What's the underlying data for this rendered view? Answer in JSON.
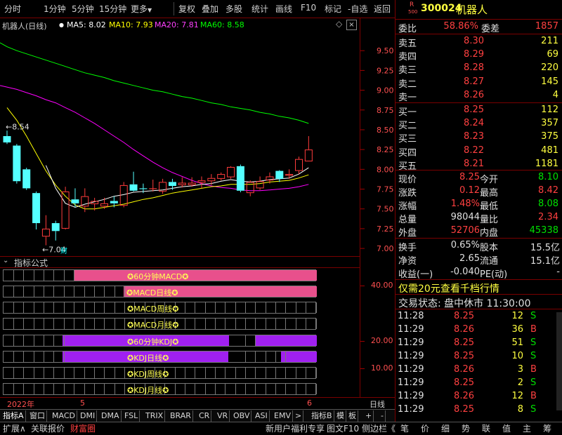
{
  "toolbar": {
    "items": [
      "分时",
      "1分钟",
      "5分钟",
      "15分钟",
      "更多",
      "复权",
      "叠加",
      "多股",
      "统计",
      "画线",
      "F10",
      "标记",
      "-自选",
      "返回"
    ]
  },
  "chart": {
    "title": "机器人(日线)",
    "ma5_label": "MA5: 8.02",
    "ma10_label": "MA10: 7.93",
    "ma20_label": "MA20: 7.81",
    "ma60_label": "MA60: 8.58",
    "colors": {
      "ma5": "#ffffff",
      "ma10": "#ffff00",
      "ma20": "#ff00ff",
      "ma60": "#00ff00",
      "up": "#ff3c3c",
      "down": "#54ffff"
    }
  },
  "chart_data": {
    "type": "candlestick",
    "ylim": [
      6.93,
      9.75
    ],
    "y_ticks": [
      "9.50",
      "9.25",
      "9.00",
      "8.75",
      "8.50",
      "8.25",
      "8.00",
      "7.75",
      "7.50",
      "7.25",
      "7.00"
    ],
    "high_label": "8.54",
    "low_label": "7.04",
    "candles": [
      {
        "o": 8.42,
        "c": 8.34,
        "h": 8.49,
        "l": 8.32
      },
      {
        "o": 8.3,
        "c": 7.85,
        "h": 8.32,
        "l": 7.82
      },
      {
        "o": 8.0,
        "c": 7.76,
        "h": 8.02,
        "l": 7.74
      },
      {
        "o": 7.7,
        "c": 7.32,
        "h": 7.72,
        "l": 7.24
      },
      {
        "o": 7.15,
        "c": 7.25,
        "h": 7.42,
        "l": 7.04
      },
      {
        "o": 7.32,
        "c": 7.22,
        "h": 7.35,
        "l": 7.1
      },
      {
        "o": 7.25,
        "c": 7.72,
        "h": 7.78,
        "l": 7.24
      },
      {
        "o": 7.62,
        "c": 7.57,
        "h": 7.76,
        "l": 7.52
      },
      {
        "o": 7.53,
        "c": 7.66,
        "h": 7.76,
        "l": 7.46
      },
      {
        "o": 7.56,
        "c": 7.6,
        "h": 7.64,
        "l": 7.48
      },
      {
        "o": 7.53,
        "c": 7.57,
        "h": 7.64,
        "l": 7.5
      },
      {
        "o": 7.6,
        "c": 7.57,
        "h": 7.66,
        "l": 7.52
      },
      {
        "o": 7.54,
        "c": 7.8,
        "h": 7.84,
        "l": 7.52
      },
      {
        "o": 7.81,
        "c": 7.73,
        "h": 7.97,
        "l": 7.72
      },
      {
        "o": 7.76,
        "c": 7.75,
        "h": 7.82,
        "l": 7.7
      },
      {
        "o": 7.75,
        "c": 7.76,
        "h": 7.87,
        "l": 7.72
      },
      {
        "o": 7.72,
        "c": 7.84,
        "h": 7.88,
        "l": 7.69
      },
      {
        "o": 7.84,
        "c": 7.79,
        "h": 7.88,
        "l": 7.74
      },
      {
        "o": 7.8,
        "c": 7.83,
        "h": 7.9,
        "l": 7.77
      },
      {
        "o": 7.8,
        "c": 7.83,
        "h": 7.9,
        "l": 7.78
      },
      {
        "o": 7.83,
        "c": 7.86,
        "h": 7.91,
        "l": 7.76
      },
      {
        "o": 7.85,
        "c": 7.89,
        "h": 7.94,
        "l": 7.8
      },
      {
        "o": 7.88,
        "c": 7.94,
        "h": 7.96,
        "l": 7.86
      },
      {
        "o": 7.9,
        "c": 8.03,
        "h": 8.04,
        "l": 7.88
      },
      {
        "o": 8.04,
        "c": 7.73,
        "h": 8.06,
        "l": 7.71
      },
      {
        "o": 7.7,
        "c": 7.84,
        "h": 7.86,
        "l": 7.66
      },
      {
        "o": 7.76,
        "c": 7.85,
        "h": 7.91,
        "l": 7.74
      },
      {
        "o": 7.86,
        "c": 7.91,
        "h": 7.96,
        "l": 7.82
      },
      {
        "o": 7.98,
        "c": 7.88,
        "h": 7.99,
        "l": 7.84
      },
      {
        "o": 7.92,
        "c": 7.94,
        "h": 8.0,
        "l": 7.88
      },
      {
        "o": 7.98,
        "c": 8.13,
        "h": 8.16,
        "l": 7.94
      },
      {
        "o": 8.1,
        "c": 8.25,
        "h": 8.42,
        "l": 8.1
      }
    ],
    "ma5": [
      null,
      null,
      null,
      null,
      8.05,
      7.76,
      7.57,
      7.52,
      7.56,
      7.59,
      7.62,
      7.66,
      7.68,
      7.71,
      7.72,
      7.73,
      7.74,
      7.76,
      7.78,
      7.79,
      7.81,
      7.82,
      7.85,
      7.87,
      7.85,
      7.84,
      7.85,
      7.87,
      7.88,
      7.89,
      7.94,
      8.02
    ],
    "ma10": [
      8.78,
      8.62,
      8.42,
      8.2,
      7.98,
      7.8,
      7.66,
      7.55,
      7.5,
      7.5,
      7.52,
      7.54,
      7.56,
      7.59,
      7.62,
      7.64,
      7.67,
      7.7,
      7.72,
      7.74,
      7.76,
      7.78,
      7.79,
      7.81,
      7.81,
      7.81,
      7.82,
      7.84,
      7.85,
      7.86,
      7.89,
      7.93
    ],
    "ma20": [
      9.04,
      9.01,
      8.97,
      8.93,
      8.88,
      8.84,
      8.78,
      8.72,
      8.65,
      8.58,
      8.5,
      8.42,
      8.34,
      8.25,
      8.17,
      8.09,
      8.02,
      7.96,
      7.91,
      7.86,
      7.82,
      7.79,
      7.77,
      7.76,
      7.74,
      7.73,
      7.73,
      7.74,
      7.75,
      7.76,
      7.78,
      7.81
    ],
    "ma60": [
      9.55,
      9.5,
      9.46,
      9.42,
      9.38,
      9.34,
      9.3,
      9.26,
      9.22,
      9.19,
      9.16,
      9.12,
      9.09,
      9.06,
      9.03,
      9.0,
      8.98,
      8.95,
      8.92,
      8.9,
      8.87,
      8.84,
      8.82,
      8.79,
      8.77,
      8.75,
      8.72,
      8.7,
      8.67,
      8.65,
      8.62,
      8.58
    ],
    "indicator_ticks": [
      "40.00",
      "20.00",
      "10.00"
    ]
  },
  "indicator": {
    "header": "指标公式",
    "rows": [
      {
        "label": "✪60分钟MACD✪",
        "color": "#e8508c"
      },
      {
        "label": "✪MACD日线✪",
        "color": "#e8508c"
      },
      {
        "label": "✪MACD周线✪",
        "color": ""
      },
      {
        "label": "✪MACD月线✪",
        "color": ""
      },
      {
        "label": "✪60分钟KDJ✪",
        "color": "#a020f0"
      },
      {
        "label": "✪KDJ日线✪",
        "color": "#a020f0"
      },
      {
        "label": "✪KDJ周线✪",
        "color": ""
      },
      {
        "label": "✪KDJ月线✪",
        "color": ""
      }
    ]
  },
  "date_bar": {
    "year": "2022年",
    "m5": "5",
    "m6": "6",
    "period": "日线"
  },
  "tabs": [
    "指标A",
    "窗口",
    "MACD",
    "DMI",
    "DMA",
    "FSL",
    "TRIX",
    "BRAR",
    "CR",
    "VR",
    "OBV",
    "ASI",
    "EMV",
    ">",
    "指标B",
    "模",
    "板",
    "+",
    "-"
  ],
  "status": {
    "left": [
      "扩展∧",
      "关联报价",
      "财富圈"
    ],
    "mid": [
      "新用户福利专享",
      "图文F10",
      "侧边栏《"
    ],
    "right": [
      "笔",
      "价",
      "细",
      "势",
      "联",
      "值",
      "主",
      "筹"
    ]
  },
  "quote": {
    "code": "300024",
    "name": "机器人",
    "badge_top": "R",
    "badge_bottom": "500",
    "weibi_label": "委比",
    "weibi": "58.86%",
    "weicha_label": "委差",
    "weicha": "1857",
    "asks": [
      {
        "label": "卖五",
        "price": "8.30",
        "vol": "211"
      },
      {
        "label": "卖四",
        "price": "8.29",
        "vol": "69"
      },
      {
        "label": "卖三",
        "price": "8.28",
        "vol": "220"
      },
      {
        "label": "卖二",
        "price": "8.27",
        "vol": "145"
      },
      {
        "label": "卖一",
        "price": "8.26",
        "vol": "4"
      }
    ],
    "bids": [
      {
        "label": "买一",
        "price": "8.25",
        "vol": "112"
      },
      {
        "label": "买二",
        "price": "8.24",
        "vol": "357"
      },
      {
        "label": "买三",
        "price": "8.23",
        "vol": "375"
      },
      {
        "label": "买四",
        "price": "8.22",
        "vol": "481"
      },
      {
        "label": "买五",
        "price": "8.21",
        "vol": "1181"
      }
    ],
    "stats": [
      {
        "l1": "现价",
        "v1": "8.25",
        "c1": "red",
        "l2": "今开",
        "v2": "8.10",
        "c2": "green"
      },
      {
        "l1": "涨跌",
        "v1": "0.12",
        "c1": "red",
        "l2": "最高",
        "v2": "8.42",
        "c2": "red"
      },
      {
        "l1": "涨幅",
        "v1": "1.48%",
        "c1": "red",
        "l2": "最低",
        "v2": "8.08",
        "c2": "green"
      },
      {
        "l1": "总量",
        "v1": "98044",
        "c1": "white",
        "l2": "量比",
        "v2": "2.34",
        "c2": "red"
      },
      {
        "l1": "外盘",
        "v1": "52706",
        "c1": "red",
        "l2": "内盘",
        "v2": "45338",
        "c2": "green"
      }
    ],
    "stats2": [
      {
        "l1": "换手",
        "v1": "0.65%",
        "l2": "股本",
        "v2": "15.5亿"
      },
      {
        "l1": "净资",
        "v1": "2.65",
        "l2": "流通",
        "v2": "15.1亿"
      },
      {
        "l1": "收益(一)",
        "v1": "-0.040",
        "l2": "PE(动)",
        "v2": "-"
      }
    ],
    "promo": "仅需20元查看千档行情",
    "trade_status": "交易状态: 盘中休市 11:30:00",
    "ticks": [
      {
        "time": "11:28",
        "price": "8.25",
        "vol": "12",
        "side": "S"
      },
      {
        "time": "11:29",
        "price": "8.26",
        "vol": "36",
        "side": "B"
      },
      {
        "time": "11:29",
        "price": "8.25",
        "vol": "51",
        "side": "S"
      },
      {
        "time": "11:29",
        "price": "8.25",
        "vol": "10",
        "side": "S"
      },
      {
        "time": "11:29",
        "price": "8.26",
        "vol": "3",
        "side": "B"
      },
      {
        "time": "11:29",
        "price": "8.25",
        "vol": "2",
        "side": "S"
      },
      {
        "time": "11:29",
        "price": "8.26",
        "vol": "12",
        "side": "B"
      },
      {
        "time": "11:29",
        "price": "8.25",
        "vol": "8",
        "side": "S"
      }
    ]
  }
}
